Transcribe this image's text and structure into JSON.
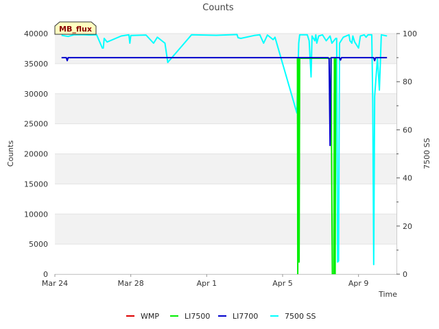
{
  "chart_data": {
    "type": "line",
    "title": "Counts",
    "xlabel": "Time",
    "ylabel": "Counts",
    "y2label": "7500 SS",
    "badge": "MB_flux",
    "x_ticks": [
      "Mar 24",
      "Mar 28",
      "Apr 1",
      "Apr 5",
      "Apr 9"
    ],
    "x_tick_days": [
      0,
      4,
      8,
      12,
      16
    ],
    "xlim_days": [
      0,
      18
    ],
    "ylim": [
      0,
      40000
    ],
    "y_ticks": [
      "0",
      "5000",
      "10000",
      "15000",
      "20000",
      "25000",
      "30000",
      "35000",
      "40000"
    ],
    "y2lim": [
      0,
      100
    ],
    "y2_ticks": [
      "0",
      "20",
      "40",
      "60",
      "80",
      "100"
    ],
    "grid_bands": true,
    "legend_position": "bottom",
    "series": [
      {
        "name": "WMP",
        "axis": "left",
        "color": "#dd0000",
        "points": []
      },
      {
        "name": "LI7500",
        "axis": "left",
        "color": "#00ee00",
        "points": [
          [
            12.78,
            35900
          ],
          [
            12.8,
            0
          ],
          [
            12.83,
            35900
          ],
          [
            12.87,
            2000
          ],
          [
            12.9,
            35900
          ],
          [
            12.95,
            35900
          ],
          [
            14.55,
            35900
          ],
          [
            14.58,
            20000
          ],
          [
            14.62,
            0
          ],
          [
            14.7,
            0
          ],
          [
            14.73,
            35900
          ],
          [
            14.77,
            0
          ],
          [
            14.8,
            35900
          ]
        ]
      },
      {
        "name": "LI7700",
        "axis": "left",
        "color": "#0000cc",
        "points": [
          [
            0.35,
            36000
          ],
          [
            0.6,
            36000
          ],
          [
            0.65,
            35500
          ],
          [
            0.7,
            36000
          ],
          [
            14.3,
            36000
          ],
          [
            14.4,
            36000
          ],
          [
            14.45,
            35800
          ],
          [
            14.5,
            21400
          ],
          [
            14.55,
            36000
          ],
          [
            15.0,
            36000
          ],
          [
            15.05,
            35600
          ],
          [
            15.1,
            36000
          ],
          [
            16.8,
            36000
          ],
          [
            16.85,
            35500
          ],
          [
            16.9,
            36000
          ],
          [
            17.5,
            36000
          ]
        ]
      },
      {
        "name": "7500 SS",
        "axis": "right",
        "color": "#00ffff",
        "points": [
          [
            0.35,
            99.3
          ],
          [
            0.7,
            98.8
          ],
          [
            1.0,
            99.5
          ],
          [
            1.5,
            99.5
          ],
          [
            1.9,
            99.4
          ],
          [
            2.2,
            99.5
          ],
          [
            2.5,
            94
          ],
          [
            2.55,
            94
          ],
          [
            2.6,
            98
          ],
          [
            2.75,
            96.5
          ],
          [
            3.5,
            99
          ],
          [
            3.9,
            99.5
          ],
          [
            3.95,
            96
          ],
          [
            4.0,
            99.2
          ],
          [
            4.8,
            99.4
          ],
          [
            5.2,
            96
          ],
          [
            5.4,
            98.5
          ],
          [
            5.8,
            96
          ],
          [
            5.95,
            88
          ],
          [
            6.0,
            88.5
          ],
          [
            7.2,
            99.5
          ],
          [
            8.5,
            99.3
          ],
          [
            9.6,
            99.6
          ],
          [
            9.65,
            98.3
          ],
          [
            9.8,
            98
          ],
          [
            10.5,
            99.2
          ],
          [
            10.8,
            99.5
          ],
          [
            11.0,
            96
          ],
          [
            11.2,
            99.4
          ],
          [
            11.5,
            97.5
          ],
          [
            11.6,
            98.5
          ],
          [
            12.75,
            67
          ],
          [
            12.85,
            96
          ],
          [
            12.9,
            99.5
          ],
          [
            13.3,
            99.5
          ],
          [
            13.4,
            97
          ],
          [
            13.5,
            82
          ],
          [
            13.55,
            99
          ],
          [
            13.7,
            97
          ],
          [
            13.75,
            99.5
          ],
          [
            13.8,
            96
          ],
          [
            13.9,
            99
          ],
          [
            14.1,
            99.5
          ],
          [
            14.3,
            97
          ],
          [
            14.5,
            99
          ],
          [
            14.6,
            96
          ],
          [
            14.8,
            98
          ],
          [
            14.85,
            98
          ],
          [
            14.9,
            5
          ],
          [
            14.95,
            5.5
          ],
          [
            15.0,
            96
          ],
          [
            15.2,
            98.5
          ],
          [
            15.5,
            99.5
          ],
          [
            15.55,
            97
          ],
          [
            15.65,
            96
          ],
          [
            15.7,
            99
          ],
          [
            15.8,
            96.5
          ],
          [
            16.0,
            94
          ],
          [
            16.1,
            99
          ],
          [
            16.3,
            99.5
          ],
          [
            16.4,
            98.5
          ],
          [
            16.5,
            99.5
          ],
          [
            16.7,
            99.5
          ],
          [
            16.75,
            72
          ],
          [
            16.8,
            4
          ],
          [
            16.85,
            74
          ],
          [
            17.0,
            90
          ],
          [
            17.1,
            76.5
          ],
          [
            17.2,
            99.5
          ],
          [
            17.5,
            99
          ]
        ]
      }
    ]
  }
}
